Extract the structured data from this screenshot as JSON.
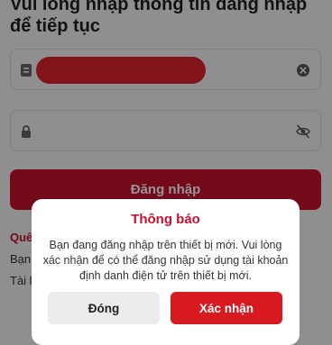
{
  "header": {
    "instruction": "Vui lòng nhập thông tin đăng nhập để tiếp tục"
  },
  "form": {
    "username_value": "",
    "password_value": "",
    "login_label": "Đăng nhập"
  },
  "background_links": {
    "forgot": "Quê",
    "line1": "Bạn",
    "line2": "Tài k"
  },
  "dialog": {
    "title": "Thông báo",
    "message": "Bạn đang đăng nhập trên thiết bị mới. Vui lòng xác nhận để có thể đăng nhập sử dụng tài khoản định danh điện tử trên thiết bị mới.",
    "close_label": "Đóng",
    "confirm_label": "Xác nhận"
  },
  "colors": {
    "brand_red": "#c8102e",
    "confirm_red": "#d71920",
    "redaction_red": "#e0212e"
  },
  "icons": {
    "username_field": "id-card-icon",
    "clear": "clear-circle-icon",
    "password_field": "lock-icon",
    "visibility": "eye-slash-icon"
  }
}
